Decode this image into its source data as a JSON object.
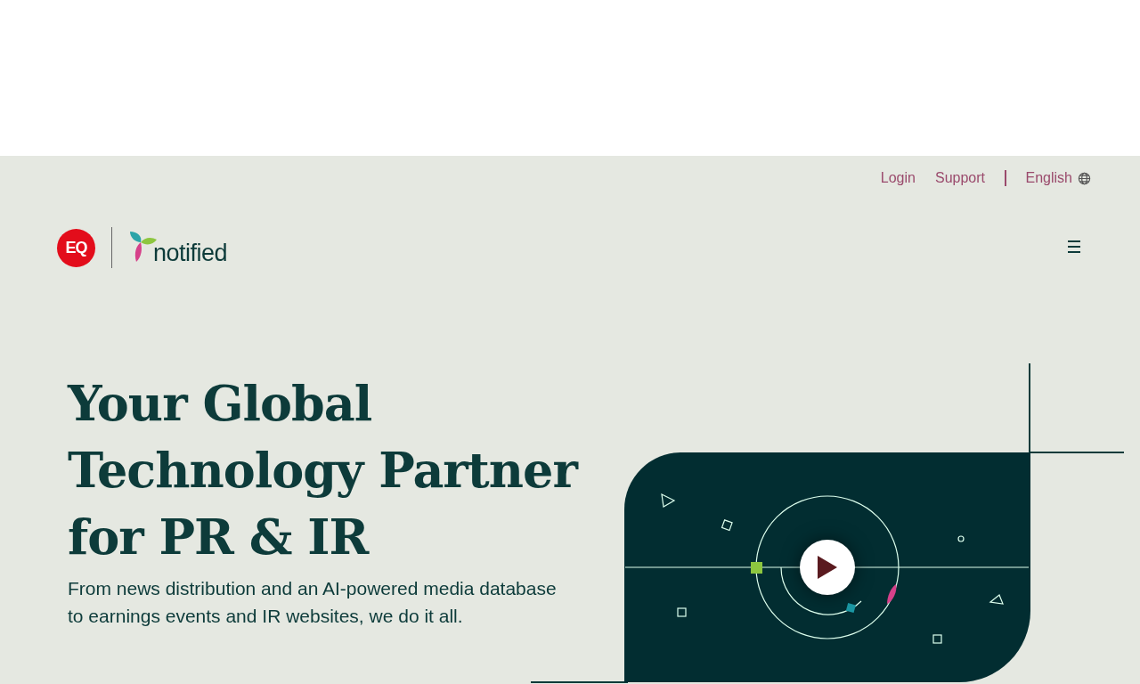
{
  "utility_nav": {
    "links": [
      {
        "label": "Login"
      },
      {
        "label": "Support"
      }
    ],
    "language": "English"
  },
  "header": {
    "eq_logo": "EQ",
    "brand_name": "notified"
  },
  "hero": {
    "title": "Your Global Technology Partner for PR & IR",
    "subtitle": "From news distribution and an AI-powered media database to earnings events and IR websites, we do it all."
  }
}
